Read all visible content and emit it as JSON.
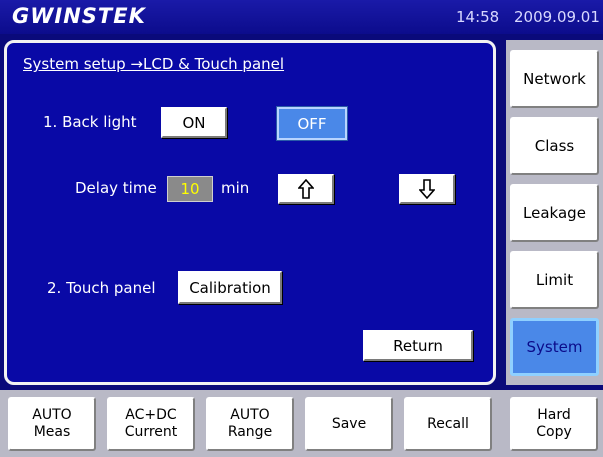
{
  "header": {
    "brand": "GWINSTEK",
    "time": "14:58",
    "date": "2009.09.01"
  },
  "main": {
    "breadcrumb": "System setup →LCD & Touch panel",
    "backlight": {
      "label": "1. Back light",
      "on_label": "ON",
      "off_label": "OFF",
      "selected": "OFF"
    },
    "delay": {
      "label": "Delay time",
      "value": "10",
      "unit": "min"
    },
    "touch": {
      "label": "2. Touch panel",
      "calibration_label": "Calibration"
    },
    "return_label": "Return"
  },
  "sidebar": {
    "items": [
      {
        "label": "Network"
      },
      {
        "label": "Class"
      },
      {
        "label": "Leakage"
      },
      {
        "label": "Limit"
      },
      {
        "label": "System"
      }
    ],
    "active": "System"
  },
  "bottom_bar": {
    "buttons": [
      {
        "line1": "AUTO",
        "line2": "Meas"
      },
      {
        "line1": "AC+DC",
        "line2": "Current"
      },
      {
        "line1": "AUTO",
        "line2": "Range"
      },
      {
        "line1": "Save",
        "line2": ""
      },
      {
        "line1": "Recall",
        "line2": ""
      },
      {
        "line1": "Hard",
        "line2": "Copy"
      }
    ]
  },
  "colors": {
    "background": "#0a0a7a",
    "panel": "#0909a6",
    "accent_selected": "#4a88e8",
    "value_text": "#ffff00"
  },
  "icons": [
    "up-arrow-icon",
    "down-arrow-icon"
  ]
}
